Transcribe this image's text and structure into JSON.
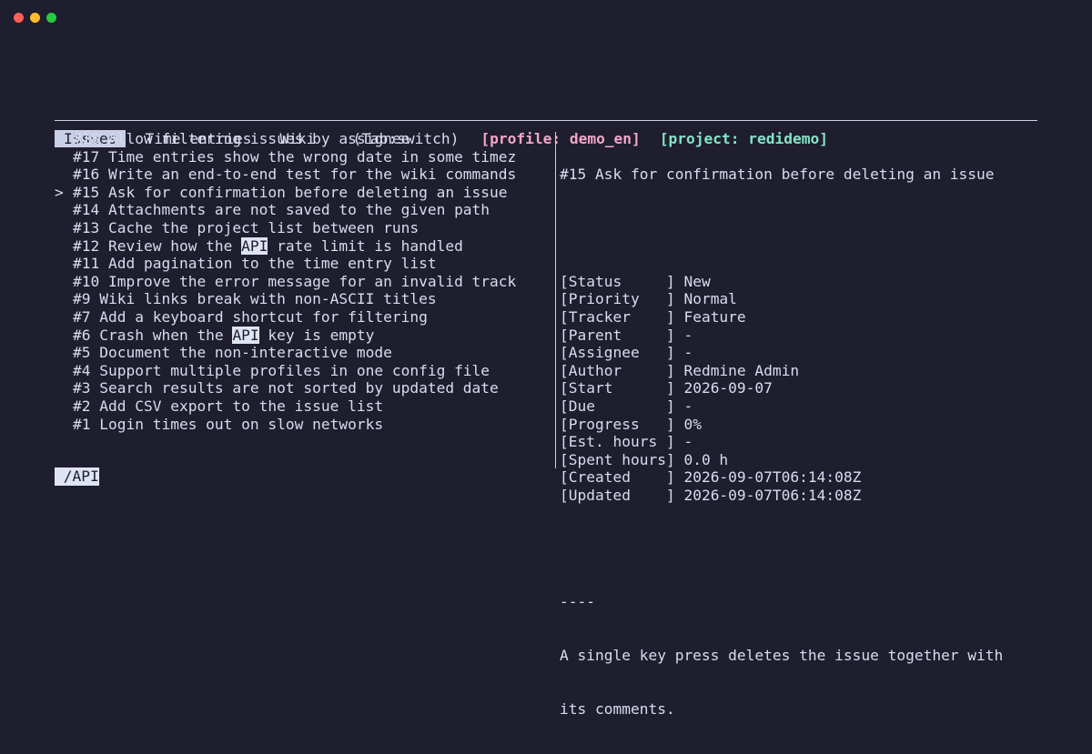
{
  "window_controls": [
    "close",
    "minimize",
    "maximize"
  ],
  "tabs": [
    {
      "label": "Issues",
      "active": true
    },
    {
      "label": "Time entries",
      "active": false
    },
    {
      "label": "Wiki",
      "active": false
    }
  ],
  "tab_hint": "(Tab:switch)",
  "profile_label": "[profile: demo_en]",
  "project_label": "[project: redidemo]",
  "search_term": "API",
  "issues": [
    {
      "text": "#18 Allow filtering issues by assignee",
      "selected": false
    },
    {
      "text": "#17 Time entries show the wrong date in some timez",
      "selected": false
    },
    {
      "text": "#16 Write an end-to-end test for the wiki commands",
      "selected": false
    },
    {
      "text": "#15 Ask for confirmation before deleting an issue",
      "selected": true
    },
    {
      "text": "#14 Attachments are not saved to the given path",
      "selected": false
    },
    {
      "text": "#13 Cache the project list between runs",
      "selected": false
    },
    {
      "text": "#12 Review how the API rate limit is handled",
      "selected": false
    },
    {
      "text": "#11 Add pagination to the time entry list",
      "selected": false
    },
    {
      "text": "#10 Improve the error message for an invalid track",
      "selected": false
    },
    {
      "text": "#9 Wiki links break with non-ASCII titles",
      "selected": false
    },
    {
      "text": "#7 Add a keyboard shortcut for filtering",
      "selected": false
    },
    {
      "text": "#6 Crash when the API key is empty",
      "selected": false
    },
    {
      "text": "#5 Document the non-interactive mode",
      "selected": false
    },
    {
      "text": "#4 Support multiple profiles in one config file",
      "selected": false
    },
    {
      "text": "#3 Search results are not sorted by updated date",
      "selected": false
    },
    {
      "text": "#2 Add CSV export to the issue list",
      "selected": false
    },
    {
      "text": "#1 Login times out on slow networks",
      "selected": false
    }
  ],
  "cursor_glyph": ">",
  "detail": {
    "title": "#15 Ask for confirmation before deleting an issue",
    "fields": [
      {
        "label": "[Status     ]",
        "value": "New"
      },
      {
        "label": "[Priority   ]",
        "value": "Normal"
      },
      {
        "label": "[Tracker    ]",
        "value": "Feature"
      },
      {
        "label": "[Parent     ]",
        "value": "-"
      },
      {
        "label": "[Assignee   ]",
        "value": "-"
      },
      {
        "label": "[Author     ]",
        "value": "Redmine Admin"
      },
      {
        "label": "[Start      ]",
        "value": "2026-09-07"
      },
      {
        "label": "[Due        ]",
        "value": "-"
      },
      {
        "label": "[Progress   ]",
        "value": "0%"
      },
      {
        "label": "[Est. hours ]",
        "value": "-"
      },
      {
        "label": "[Spent hours]",
        "value": "0.0 h"
      },
      {
        "label": "[Created    ]",
        "value": "2026-09-07T06:14:08Z"
      },
      {
        "label": "[Updated    ]",
        "value": "2026-09-07T06:14:08Z"
      }
    ],
    "separator": "----",
    "description_lines": [
      "A single key press deletes the issue together with",
      "its comments."
    ]
  },
  "command_line": " /API"
}
